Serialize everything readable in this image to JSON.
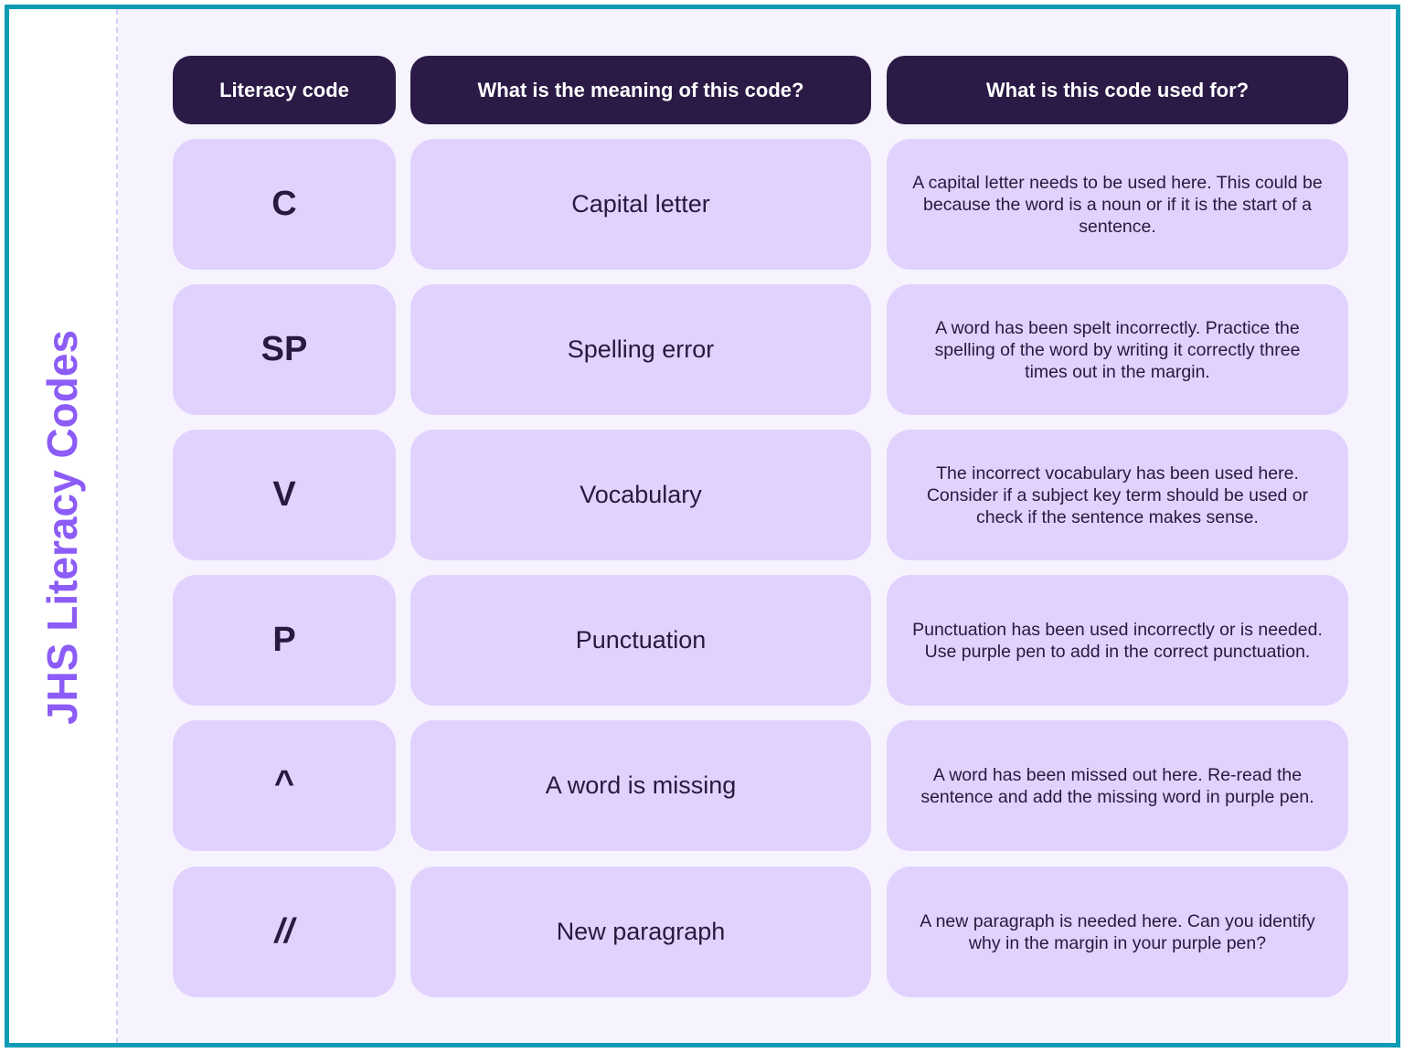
{
  "title": "JHS Literacy Codes",
  "colors": {
    "frame": "#0e9bb4",
    "title": "#8c5cf6",
    "header_bg": "#2a1a45",
    "cell_bg": "#e1d2fd",
    "page_bg": "#f6f3fe",
    "text": "#27193f"
  },
  "table": {
    "headers": [
      "Literacy code",
      "What is the meaning of this code?",
      "What is this code used for?"
    ],
    "rows": [
      {
        "code": "C",
        "meaning": "Capital letter",
        "use": "A capital letter needs to be used here. This could be because the word is a noun or if it is the start of a sentence."
      },
      {
        "code": "SP",
        "meaning": "Spelling error",
        "use": "A word has been spelt incorrectly. Practice the spelling of the word by writing it correctly three times out in the margin."
      },
      {
        "code": "V",
        "meaning": "Vocabulary",
        "use": "The incorrect vocabulary has been used here. Consider if a subject key term should be used or check if the sentence makes sense."
      },
      {
        "code": "P",
        "meaning": "Punctuation",
        "use": "Punctuation has been used incorrectly or is needed. Use purple pen to add in the correct punctuation."
      },
      {
        "code": "^",
        "meaning": "A word is missing",
        "use": "A word has been missed out here. Re-read the sentence and add the missing word in purple pen."
      },
      {
        "code": "//",
        "meaning": "New paragraph",
        "use": "A new paragraph is needed here. Can you identify why in the margin in your purple pen?"
      }
    ]
  }
}
